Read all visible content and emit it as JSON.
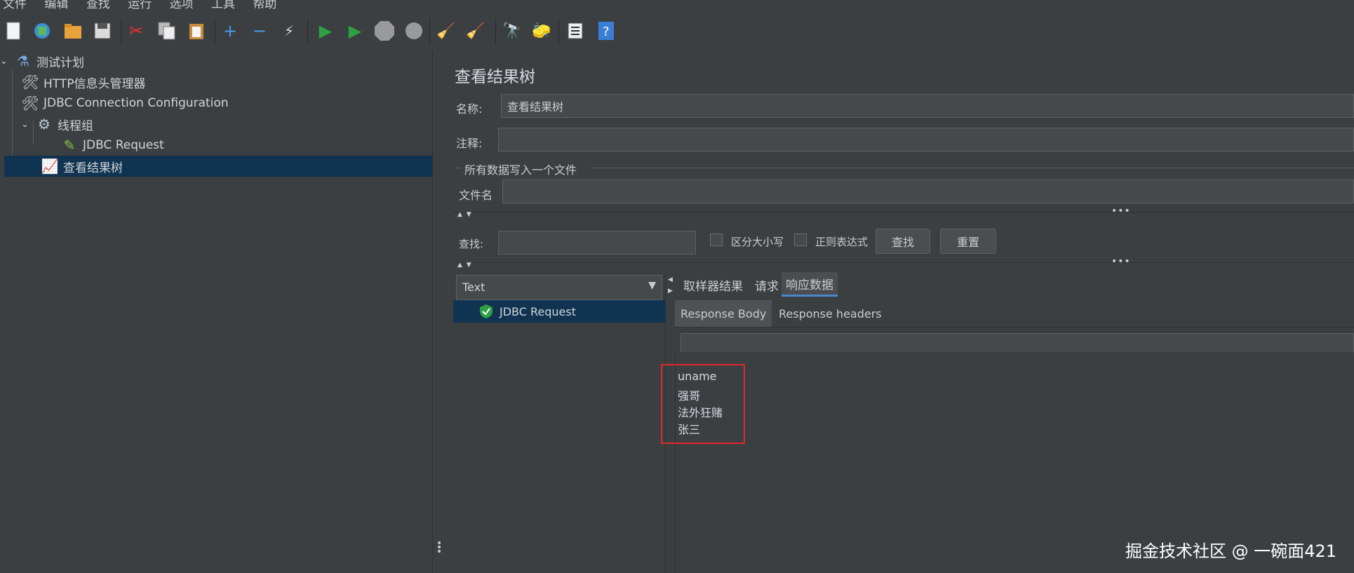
{
  "menu": [
    "文件",
    "编辑",
    "查找",
    "运行",
    "选项",
    "工具",
    "帮助"
  ],
  "tree": {
    "items": [
      {
        "label": "测试计划",
        "icon": "flask-icon",
        "glyph": "🧪"
      },
      {
        "label": "HTTP信息头管理器",
        "icon": "tools-icon",
        "glyph": "🛠"
      },
      {
        "label": "JDBC Connection Configuration",
        "icon": "tools-icon",
        "glyph": "🛠"
      },
      {
        "label": "线程组",
        "icon": "gear-icon",
        "glyph": "⚙"
      },
      {
        "label": "JDBC Request",
        "icon": "pipette-icon",
        "glyph": "🖊"
      },
      {
        "label": "查看结果树",
        "icon": "chart-icon",
        "glyph": "📈"
      }
    ]
  },
  "panel": {
    "title": "查看结果树",
    "name_label": "名称:",
    "name_value": "查看结果树",
    "comment_label": "注释:",
    "comment_value": "",
    "file_group_label": "所有数据写入一个文件",
    "file_label": "文件名",
    "file_value": "",
    "search_label": "查找:",
    "search_value": "",
    "case_sensitive": "区分大小写",
    "regex": "正则表达式",
    "find_button": "查找",
    "reset_button": "重置",
    "renderer": "Text",
    "result_item": "JDBC Request",
    "tabs": [
      "取样器结果",
      "请求",
      "响应数据"
    ],
    "subtabs": [
      "Response Body",
      "Response headers"
    ],
    "response_lines": [
      "uname",
      "强哥",
      "法外狂赌",
      "张三"
    ]
  },
  "watermark": "掘金技术社区 @ 一碗面421",
  "colors": {
    "selection": "#0f3350",
    "highlight_box": "#e0282b",
    "tab_underline": "#4a88c7"
  }
}
